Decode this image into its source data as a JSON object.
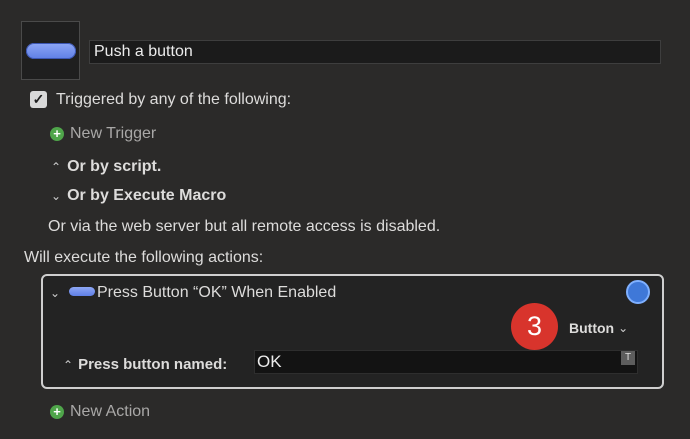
{
  "macro": {
    "name": "Push a button"
  },
  "triggers": {
    "checkbox_label": "Triggered by any of the following:",
    "new_trigger": "New Trigger",
    "or_by_script": "Or by script.",
    "or_by_execute_macro": "Or by Execute Macro",
    "web_server_note": "Or via the web server but all remote access is disabled."
  },
  "actions": {
    "heading": "Will execute the following actions:",
    "action_title": "Press Button “OK” When Enabled",
    "badge": "3",
    "button_dropdown": "Button",
    "press_button_label": "Press button named:",
    "press_button_value": "OK",
    "token_label": "T",
    "new_action": "New Action"
  },
  "colors": {
    "accent": "#5f7fe6",
    "badge": "#d8342c",
    "add": "#4fa54a"
  }
}
